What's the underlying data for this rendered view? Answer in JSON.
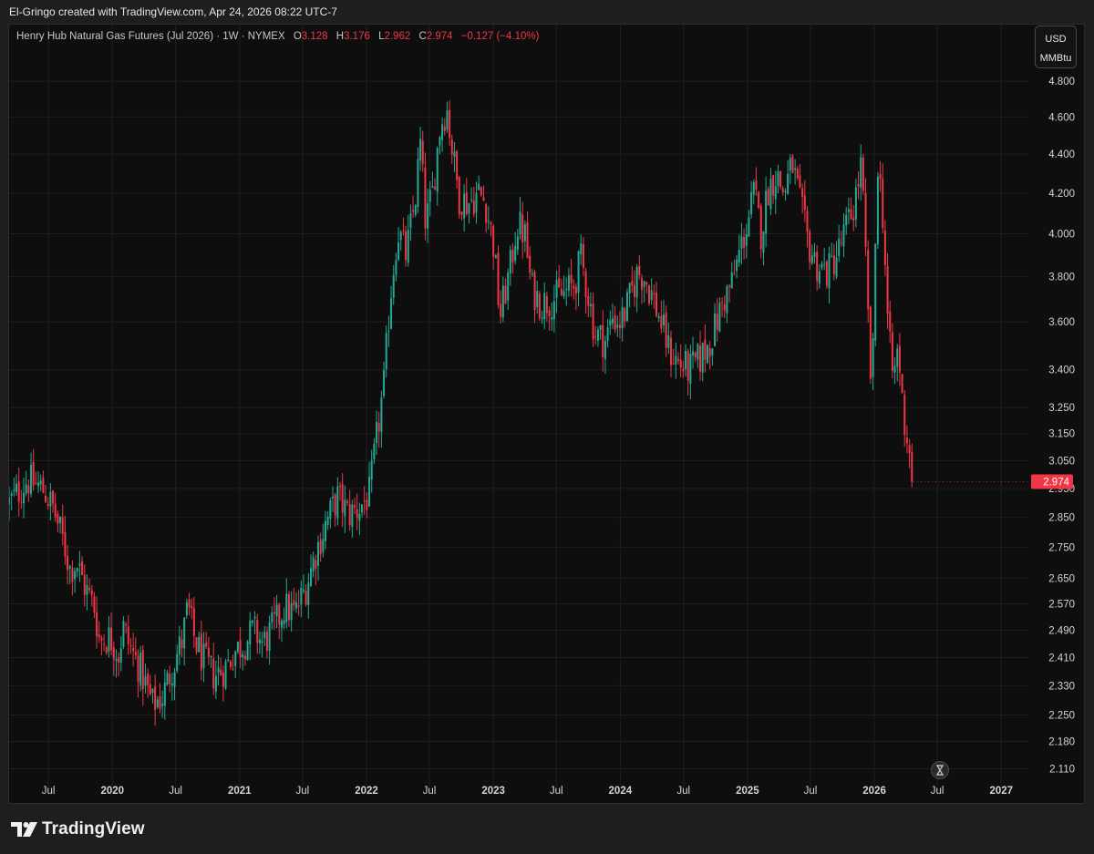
{
  "header": {
    "credit": "El-Gringo created with TradingView.com, Apr 24, 2026 08:22 UTC-7"
  },
  "legend": {
    "symbol": "Henry Hub Natural Gas Futures (Jul 2026) · 1W · NYMEX",
    "open_label": "O",
    "open": "3.128",
    "high_label": "H",
    "high": "3.176",
    "low_label": "L",
    "low": "2.962",
    "close_label": "C",
    "close": "2.974",
    "change": "−0.127 (−4.10%)"
  },
  "units": {
    "currency": "USD",
    "unit": "MMBtu"
  },
  "footer": {
    "brand": "TradingView"
  },
  "colors": {
    "up": "#22ab94",
    "down": "#f23645",
    "grid": "#1f1f1f",
    "axis_text": "#d1d4dc",
    "background": "#0e0e0e"
  },
  "chart_data": {
    "type": "candlestick",
    "interval": "1W",
    "y_scale": "log",
    "ylim": [
      2.07,
      4.95
    ],
    "xlim": [
      "2019-03-10",
      "2027-03-20"
    ],
    "y_ticks": [
      "4.800",
      "4.600",
      "4.400",
      "4.200",
      "4.000",
      "3.800",
      "3.600",
      "3.400",
      "3.250",
      "3.150",
      "3.050",
      "2.950",
      "2.850",
      "2.750",
      "2.650",
      "2.570",
      "2.490",
      "2.410",
      "2.330",
      "2.250",
      "2.180",
      "2.110"
    ],
    "x_ticks": [
      {
        "label": "Jul",
        "date": "2019-07-01",
        "bold": false
      },
      {
        "label": "2020",
        "date": "2020-01-01",
        "bold": true
      },
      {
        "label": "Jul",
        "date": "2020-07-01",
        "bold": false
      },
      {
        "label": "2021",
        "date": "2021-01-01",
        "bold": true
      },
      {
        "label": "Jul",
        "date": "2021-07-01",
        "bold": false
      },
      {
        "label": "2022",
        "date": "2022-01-01",
        "bold": true
      },
      {
        "label": "Jul",
        "date": "2022-07-01",
        "bold": false
      },
      {
        "label": "2023",
        "date": "2023-01-01",
        "bold": true
      },
      {
        "label": "Jul",
        "date": "2023-07-01",
        "bold": false
      },
      {
        "label": "2024",
        "date": "2024-01-01",
        "bold": true
      },
      {
        "label": "Jul",
        "date": "2024-07-01",
        "bold": false
      },
      {
        "label": "2025",
        "date": "2025-01-01",
        "bold": true
      },
      {
        "label": "Jul",
        "date": "2025-07-01",
        "bold": false
      },
      {
        "label": "2026",
        "date": "2026-01-01",
        "bold": true
      },
      {
        "label": "Jul",
        "date": "2026-07-01",
        "bold": false
      },
      {
        "label": "2027",
        "date": "2027-01-01",
        "bold": true
      }
    ],
    "last_price_label": "2.974",
    "series": [
      {
        "date": "2019-03-10",
        "close": 2.9
      },
      {
        "date": "2019-04-01",
        "close": 2.93
      },
      {
        "date": "2019-05-01",
        "close": 2.98
      },
      {
        "date": "2019-06-01",
        "close": 2.96
      },
      {
        "date": "2019-06-20",
        "close": 2.94
      },
      {
        "date": "2019-07-15",
        "close": 2.88
      },
      {
        "date": "2019-08-15",
        "close": 2.76
      },
      {
        "date": "2019-09-01",
        "close": 2.68
      },
      {
        "date": "2019-09-20",
        "close": 2.7
      },
      {
        "date": "2019-10-15",
        "close": 2.62
      },
      {
        "date": "2019-11-10",
        "close": 2.56
      },
      {
        "date": "2019-11-25",
        "close": 2.46
      },
      {
        "date": "2019-12-25",
        "close": 2.47
      },
      {
        "date": "2020-01-20",
        "close": 2.42
      },
      {
        "date": "2020-02-01",
        "close": 2.5
      },
      {
        "date": "2020-02-20",
        "close": 2.44
      },
      {
        "date": "2020-03-20",
        "close": 2.38
      },
      {
        "date": "2020-04-10",
        "close": 2.32
      },
      {
        "date": "2020-04-25",
        "close": 2.28
      },
      {
        "date": "2020-05-25",
        "close": 2.3
      },
      {
        "date": "2020-06-20",
        "close": 2.38
      },
      {
        "date": "2020-07-20",
        "close": 2.46
      },
      {
        "date": "2020-08-05",
        "close": 2.56
      },
      {
        "date": "2020-08-25",
        "close": 2.46
      },
      {
        "date": "2020-09-20",
        "close": 2.4
      },
      {
        "date": "2020-10-20",
        "close": 2.36
      },
      {
        "date": "2020-11-20",
        "close": 2.38
      },
      {
        "date": "2020-12-20",
        "close": 2.43
      },
      {
        "date": "2021-01-20",
        "close": 2.46
      },
      {
        "date": "2021-02-10",
        "close": 2.49
      },
      {
        "date": "2021-03-10",
        "close": 2.45
      },
      {
        "date": "2021-04-20",
        "close": 2.52
      },
      {
        "date": "2021-05-10",
        "close": 2.56
      },
      {
        "date": "2021-06-10",
        "close": 2.54
      },
      {
        "date": "2021-07-10",
        "close": 2.62
      },
      {
        "date": "2021-08-10",
        "close": 2.74
      },
      {
        "date": "2021-09-10",
        "close": 2.84
      },
      {
        "date": "2021-10-10",
        "close": 2.92
      },
      {
        "date": "2021-11-10",
        "close": 2.86
      },
      {
        "date": "2021-12-10",
        "close": 2.88
      },
      {
        "date": "2022-01-10",
        "close": 2.93
      },
      {
        "date": "2022-02-01",
        "close": 3.15
      },
      {
        "date": "2022-02-20",
        "close": 3.34
      },
      {
        "date": "2022-03-10",
        "close": 3.7
      },
      {
        "date": "2022-04-01",
        "close": 4.02
      },
      {
        "date": "2022-04-25",
        "close": 3.9
      },
      {
        "date": "2022-05-20",
        "close": 4.15
      },
      {
        "date": "2022-06-05",
        "close": 4.45
      },
      {
        "date": "2022-06-20",
        "close": 4.05
      },
      {
        "date": "2022-07-10",
        "close": 4.2
      },
      {
        "date": "2022-08-01",
        "close": 4.55
      },
      {
        "date": "2022-08-20",
        "close": 4.65
      },
      {
        "date": "2022-09-10",
        "close": 4.35
      },
      {
        "date": "2022-09-25",
        "close": 4.18
      },
      {
        "date": "2022-10-20",
        "close": 4.15
      },
      {
        "date": "2022-11-20",
        "close": 4.2
      },
      {
        "date": "2022-12-10",
        "close": 4.15
      },
      {
        "date": "2023-01-01",
        "close": 3.95
      },
      {
        "date": "2023-01-20",
        "close": 3.62
      },
      {
        "date": "2023-02-20",
        "close": 3.85
      },
      {
        "date": "2023-03-10",
        "close": 4.05
      },
      {
        "date": "2023-04-01",
        "close": 4.0
      },
      {
        "date": "2023-04-20",
        "close": 3.75
      },
      {
        "date": "2023-05-20",
        "close": 3.68
      },
      {
        "date": "2023-06-20",
        "close": 3.7
      },
      {
        "date": "2023-07-20",
        "close": 3.72
      },
      {
        "date": "2023-08-20",
        "close": 3.76
      },
      {
        "date": "2023-09-10",
        "close": 3.88
      },
      {
        "date": "2023-10-01",
        "close": 3.72
      },
      {
        "date": "2023-10-20",
        "close": 3.55
      },
      {
        "date": "2023-11-20",
        "close": 3.52
      },
      {
        "date": "2023-12-10",
        "close": 3.62
      },
      {
        "date": "2024-01-01",
        "close": 3.6
      },
      {
        "date": "2024-01-20",
        "close": 3.66
      },
      {
        "date": "2024-02-20",
        "close": 3.82
      },
      {
        "date": "2024-03-10",
        "close": 3.8
      },
      {
        "date": "2024-04-01",
        "close": 3.72
      },
      {
        "date": "2024-05-01",
        "close": 3.58
      },
      {
        "date": "2024-05-20",
        "close": 3.48
      },
      {
        "date": "2024-06-20",
        "close": 3.42
      },
      {
        "date": "2024-07-20",
        "close": 3.4
      },
      {
        "date": "2024-08-20",
        "close": 3.45
      },
      {
        "date": "2024-09-10",
        "close": 3.5
      },
      {
        "date": "2024-10-01",
        "close": 3.58
      },
      {
        "date": "2024-10-20",
        "close": 3.68
      },
      {
        "date": "2024-11-20",
        "close": 3.78
      },
      {
        "date": "2024-12-10",
        "close": 3.92
      },
      {
        "date": "2025-01-01",
        "close": 4.05
      },
      {
        "date": "2025-01-20",
        "close": 4.2
      },
      {
        "date": "2025-02-10",
        "close": 4.0
      },
      {
        "date": "2025-03-01",
        "close": 4.22
      },
      {
        "date": "2025-03-25",
        "close": 4.3
      },
      {
        "date": "2025-04-15",
        "close": 4.2
      },
      {
        "date": "2025-05-10",
        "close": 4.35
      },
      {
        "date": "2025-06-01",
        "close": 4.15
      },
      {
        "date": "2025-06-25",
        "close": 3.95
      },
      {
        "date": "2025-07-20",
        "close": 3.85
      },
      {
        "date": "2025-08-20",
        "close": 3.82
      },
      {
        "date": "2025-09-20",
        "close": 3.92
      },
      {
        "date": "2025-10-10",
        "close": 4.02
      },
      {
        "date": "2025-11-01",
        "close": 4.12
      },
      {
        "date": "2025-11-25",
        "close": 4.35
      },
      {
        "date": "2025-12-10",
        "close": 3.75
      },
      {
        "date": "2025-12-25",
        "close": 3.25
      },
      {
        "date": "2026-01-10",
        "close": 4.38
      },
      {
        "date": "2026-01-25",
        "close": 4.1
      },
      {
        "date": "2026-02-10",
        "close": 3.55
      },
      {
        "date": "2026-02-25",
        "close": 3.35
      },
      {
        "date": "2026-03-10",
        "close": 3.5
      },
      {
        "date": "2026-03-25",
        "close": 3.22
      },
      {
        "date": "2026-04-10",
        "close": 3.1
      },
      {
        "date": "2026-04-24",
        "close": 2.974
      }
    ]
  }
}
